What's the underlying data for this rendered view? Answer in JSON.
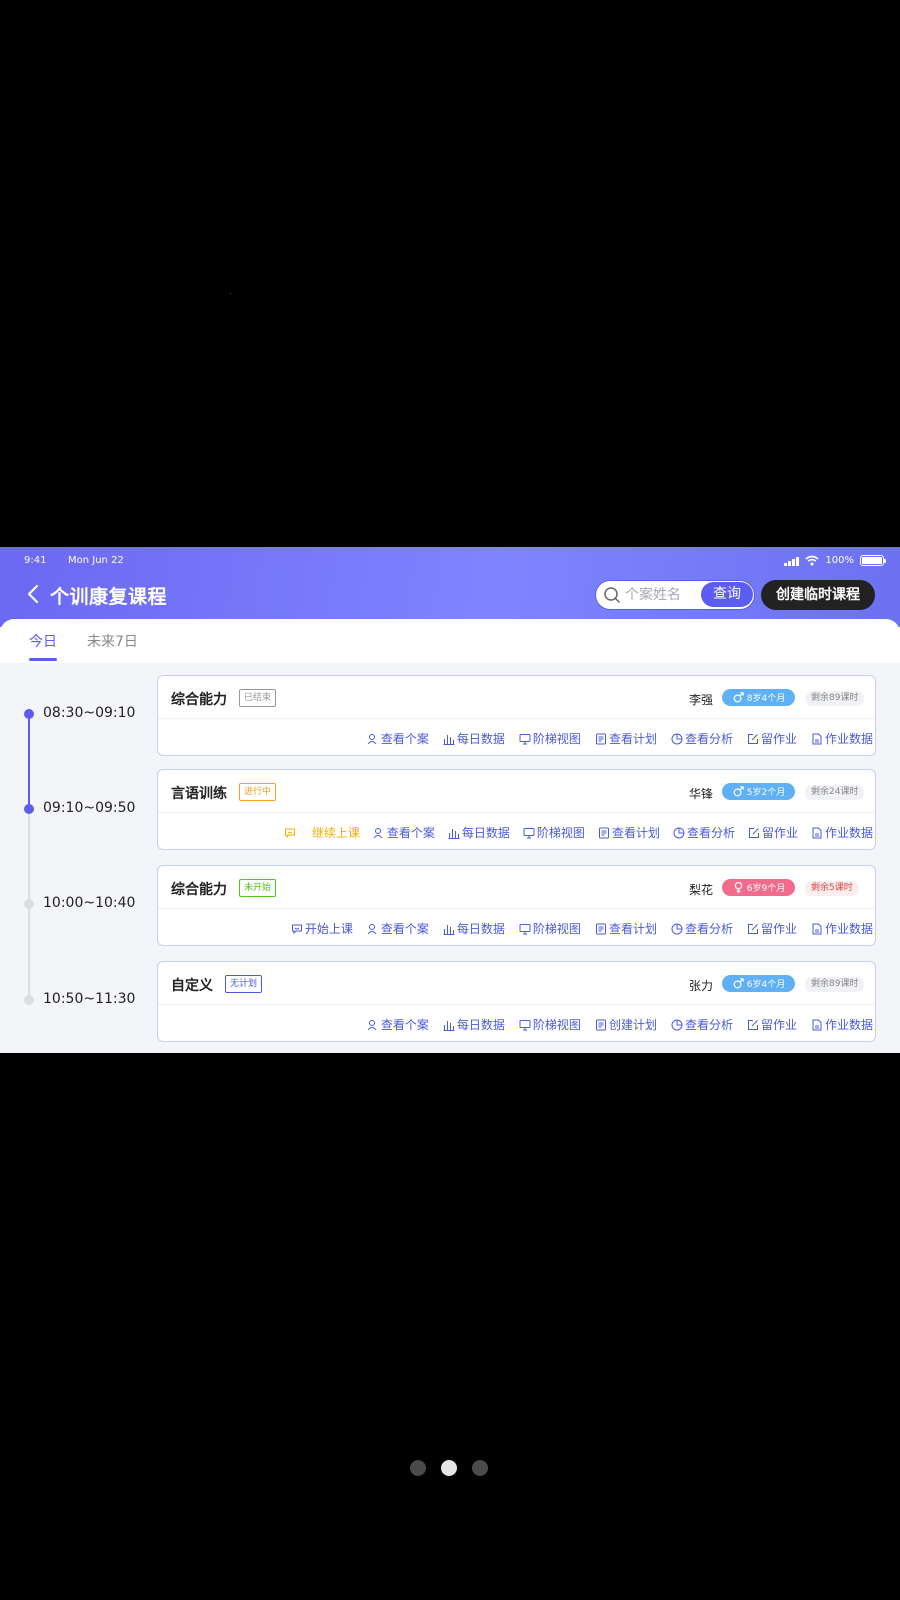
{
  "status_bar": {
    "time": "9:41",
    "date": "Mon Jun 22",
    "battery": "100%"
  },
  "header": {
    "title": "个训康复课程",
    "search_placeholder": "个案姓名",
    "search_button": "查询",
    "create_button": "创建临时课程"
  },
  "tabs": [
    {
      "label": "今日",
      "active": true
    },
    {
      "label": "未来7日",
      "active": false
    }
  ],
  "sessions": [
    {
      "time": "08:30~09:10",
      "course": "综合能力",
      "status": "已结束",
      "student": "李强",
      "gender": "male",
      "age": "8岁4个月",
      "remaining": "剩余89课时",
      "actions": [
        "查看个案",
        "每日数据",
        "阶梯视图",
        "查看计划",
        "查看分析",
        "留作业",
        "作业数据"
      ]
    },
    {
      "time": "09:10~09:50",
      "course": "言语训练",
      "status": "进行中",
      "student": "华锋",
      "gender": "male",
      "age": "5岁2个月",
      "remaining": "剩余24课时",
      "primary_action": "继续上课",
      "actions": [
        "查看个案",
        "每日数据",
        "阶梯视图",
        "查看计划",
        "查看分析",
        "留作业",
        "作业数据"
      ]
    },
    {
      "time": "10:00~10:40",
      "course": "综合能力",
      "status": "未开始",
      "student": "梨花",
      "gender": "female",
      "age": "6岁9个月",
      "remaining": "剩余5课时",
      "primary_action": "开始上课",
      "actions": [
        "查看个案",
        "每日数据",
        "阶梯视图",
        "查看计划",
        "查看分析",
        "留作业",
        "作业数据"
      ]
    },
    {
      "time": "10:50~11:30",
      "course": "自定义",
      "status": "无计划",
      "student": "张力",
      "gender": "male",
      "age": "6岁4个月",
      "remaining": "剩余89课时",
      "actions": [
        "查看个案",
        "每日数据",
        "阶梯视图",
        "创建计划",
        "查看分析",
        "留作业",
        "作业数据"
      ]
    }
  ],
  "colors": {
    "primary": "#5b5cf0",
    "header_gradient": [
      "#6b68f2",
      "#7f84ff"
    ],
    "in_progress": "#f0a020",
    "not_started": "#52c41a",
    "male": "#5fb0f5",
    "female": "#f06b8c",
    "warning": "#e04646"
  },
  "pager": {
    "pages": 3,
    "current": 2
  }
}
